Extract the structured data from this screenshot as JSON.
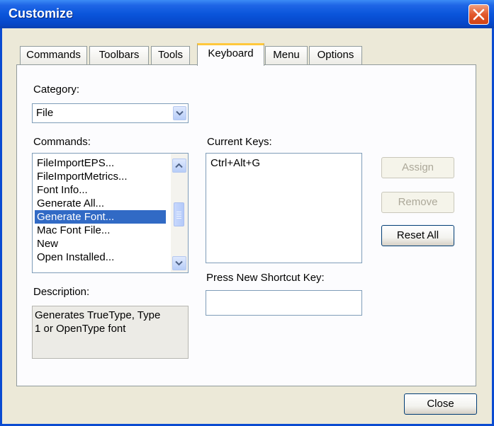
{
  "window": {
    "title": "Customize"
  },
  "tabs": [
    {
      "label": "Commands",
      "active": false
    },
    {
      "label": "Toolbars",
      "active": false
    },
    {
      "label": "Tools",
      "active": false
    },
    {
      "label": "Keyboard",
      "active": true
    },
    {
      "label": "Menu",
      "active": false
    },
    {
      "label": "Options",
      "active": false
    }
  ],
  "category": {
    "label": "Category:",
    "selected": "File"
  },
  "commands": {
    "label": "Commands:",
    "items": [
      "FileImportEPS...",
      "FileImportMetrics...",
      "Font Info...",
      "Generate All...",
      "Generate Font...",
      "Mac Font File...",
      "New",
      "Open Installed..."
    ],
    "selected_index": 4
  },
  "description": {
    "label": "Description:",
    "text_line1": "Generates TrueType, Type",
    "text_line2": "1 or OpenType font"
  },
  "current_keys": {
    "label": "Current Keys:",
    "items": [
      "Ctrl+Alt+G"
    ]
  },
  "shortcut": {
    "label": "Press New Shortcut Key:",
    "value": ""
  },
  "buttons": {
    "assign": "Assign",
    "remove": "Remove",
    "reset_all": "Reset All",
    "close": "Close"
  },
  "colors": {
    "title_bar": "#0a55db",
    "selection": "#316ac5",
    "active_tab_accent": "#ffc83c",
    "close_button": "#e2582b"
  }
}
